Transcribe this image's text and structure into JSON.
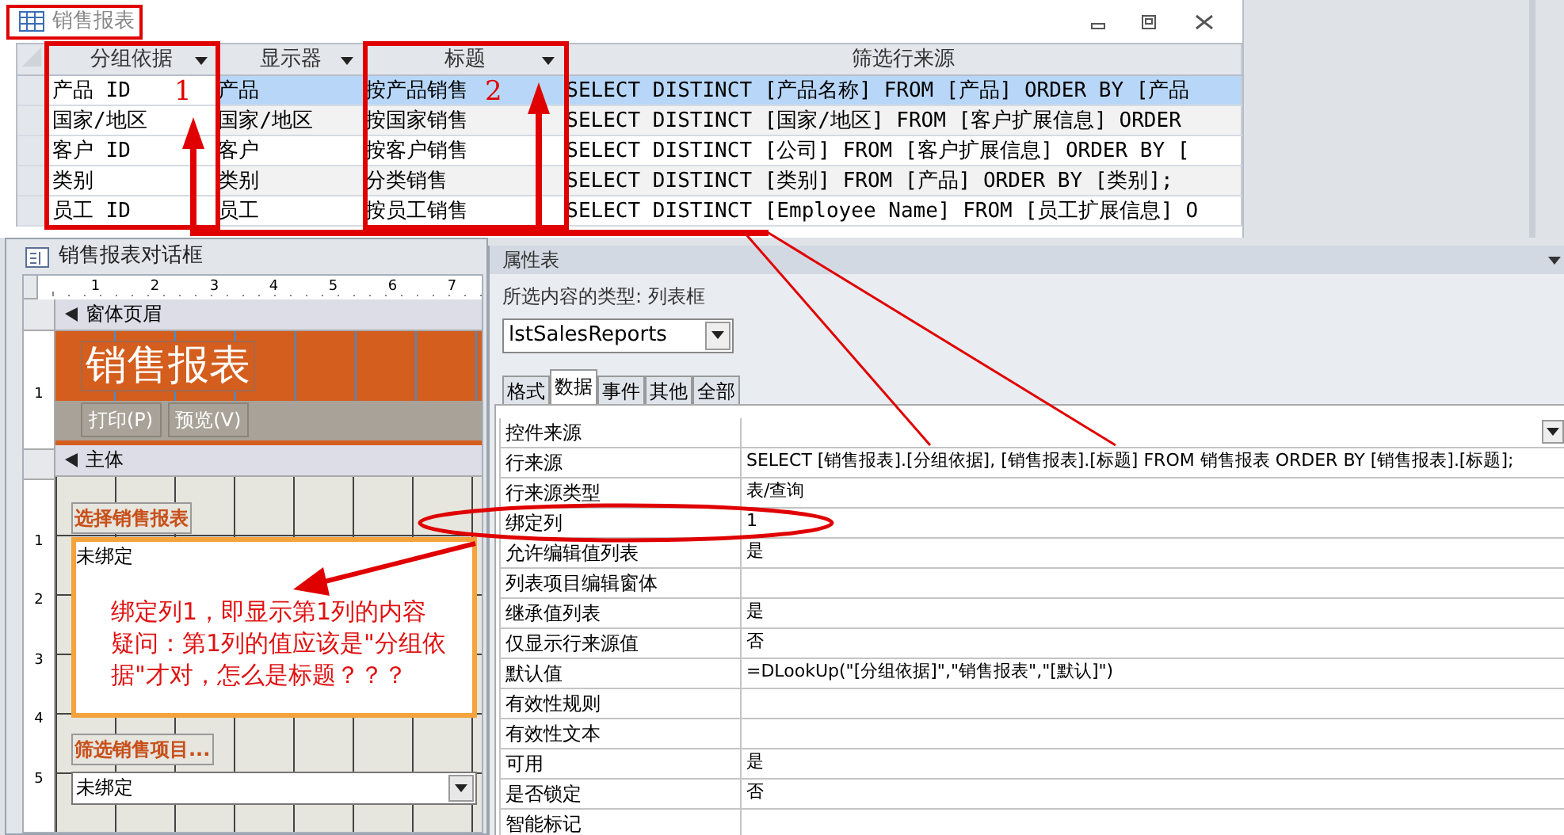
{
  "table_window": {
    "title": "销售报表",
    "columns": [
      {
        "label": "分组依据",
        "menu": true
      },
      {
        "label": "显示器",
        "menu": true
      },
      {
        "label": "标题",
        "menu": true
      },
      {
        "label": "筛选行来源",
        "menu": false
      }
    ],
    "rows": [
      {
        "selected": true,
        "cells": [
          "产品 ID",
          "产品",
          "按产品销售",
          "SELECT DISTINCT [产品名称] FROM [产品] ORDER BY [产品"
        ]
      },
      {
        "selected": false,
        "cells": [
          "国家/地区",
          "国家/地区",
          "按国家销售",
          "SELECT DISTINCT [国家/地区] FROM [客户扩展信息] ORDER"
        ]
      },
      {
        "selected": false,
        "cells": [
          "客户 ID",
          "客户",
          "按客户销售",
          "SELECT DISTINCT [公司] FROM [客户扩展信息] ORDER BY ["
        ]
      },
      {
        "selected": false,
        "cells": [
          "类别",
          "类别",
          "分类销售",
          "SELECT DISTINCT [类别] FROM [产品] ORDER BY [类别];"
        ]
      },
      {
        "selected": false,
        "cells": [
          "员工 ID",
          "员工",
          "按员工销售",
          "SELECT DISTINCT [Employee Name] FROM [员工扩展信息] O"
        ]
      }
    ]
  },
  "markers": [
    "1",
    "2"
  ],
  "form_window": {
    "title": "销售报表对话框",
    "ruler": [
      "1",
      "2",
      "3",
      "4",
      "5",
      "6",
      "7"
    ],
    "header_ruler": [
      "1"
    ],
    "body_ruler": [
      "1",
      "2",
      "3",
      "4",
      "5"
    ],
    "header_section": "窗体页眉",
    "header_title": "销售报表",
    "buttons": [
      "打印(P)",
      "预览(V)"
    ],
    "detail_section": "主体",
    "list_label": "选择销售报表",
    "list_value": "未绑定",
    "combo_label": "筛选销售项目...",
    "combo_value": "未绑定"
  },
  "note": [
    "绑定列1，即显示第1列的内容",
    "疑问：第1列的值应该是\"分组依据\"才对，怎么是标题？？？"
  ],
  "property_sheet": {
    "title": "属性表",
    "selection_type": "所选内容的类型: 列表框",
    "object": "lstSalesReports",
    "tabs": [
      {
        "label": "格式",
        "selected": false
      },
      {
        "label": "数据",
        "selected": true
      },
      {
        "label": "事件",
        "selected": false
      },
      {
        "label": "其他",
        "selected": false
      },
      {
        "label": "全部",
        "selected": false
      }
    ],
    "rows": [
      {
        "label": "控件来源",
        "kind": "combo"
      },
      {
        "label": "行来源",
        "value": "SELECT [销售报表].[分组依据], [销售报表].[标题] FROM 销售报表 ORDER BY [销售报表].[标题];"
      },
      {
        "label": "行来源类型",
        "value": "表/查询"
      },
      {
        "label": "绑定列",
        "value": "1"
      },
      {
        "label": "允许编辑值列表",
        "value": "是"
      },
      {
        "label": "列表项目编辑窗体"
      },
      {
        "label": "继承值列表",
        "value": "是"
      },
      {
        "label": "仅显示行来源值",
        "value": "否"
      },
      {
        "label": "默认值",
        "value": "=DLookUp(\"[分组依据]\",\"销售报表\",\"[默认]\")"
      },
      {
        "label": "有效性规则"
      },
      {
        "label": "有效性文本"
      },
      {
        "label": "可用",
        "value": "是"
      },
      {
        "label": "是否锁定",
        "value": "否"
      },
      {
        "label": "智能标记"
      }
    ]
  }
}
